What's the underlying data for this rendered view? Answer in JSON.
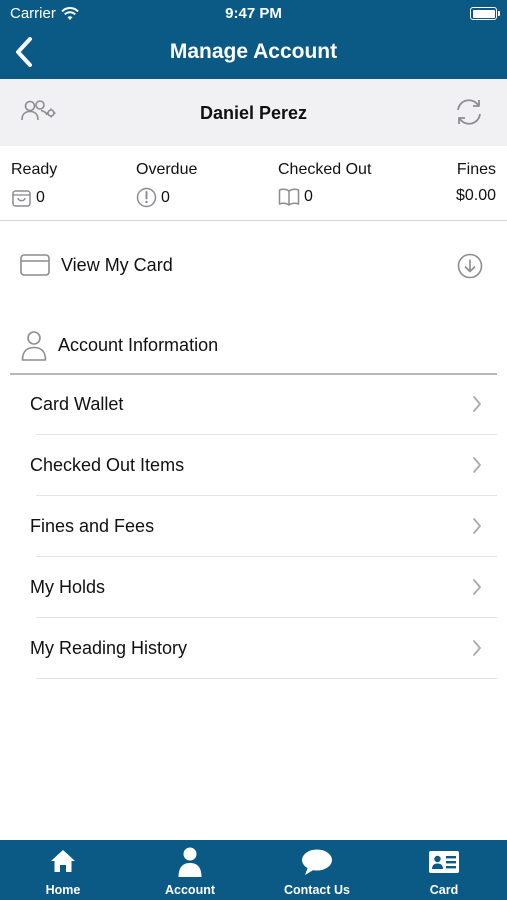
{
  "status_bar": {
    "carrier": "Carrier",
    "time": "9:47 PM",
    "battery_level": 1.0
  },
  "nav": {
    "title": "Manage Account",
    "back_icon": "chevron-left-icon"
  },
  "profile": {
    "name": "Daniel Perez",
    "left_icon": "user-switch-icon",
    "right_icon": "refresh-icon"
  },
  "stats": {
    "ready": {
      "label": "Ready",
      "value": "0",
      "icon": "bag-icon"
    },
    "overdue": {
      "label": "Overdue",
      "value": "0",
      "icon": "alert-icon"
    },
    "checked_out": {
      "label": "Checked Out",
      "value": "0",
      "icon": "book-icon"
    },
    "fines": {
      "label": "Fines",
      "value": "$0.00"
    }
  },
  "view_card": {
    "label": "View My Card",
    "icon": "credit-card-icon",
    "action_icon": "download-circle-icon"
  },
  "account": {
    "label": "Account Information",
    "icon": "person-icon",
    "items": [
      {
        "label": "Card Wallet"
      },
      {
        "label": "Checked Out Items"
      },
      {
        "label": "Fines and Fees"
      },
      {
        "label": "My Holds"
      },
      {
        "label": "My Reading History"
      }
    ]
  },
  "tabs": [
    {
      "label": "Home",
      "icon": "home-icon"
    },
    {
      "label": "Account",
      "icon": "account-icon"
    },
    {
      "label": "Contact Us",
      "icon": "chat-bubble-icon"
    },
    {
      "label": "Card",
      "icon": "id-card-icon"
    }
  ],
  "colors": {
    "brand": "#0a5a85",
    "profile_bg": "#f1f1f4",
    "icon_gray": "#8c8c92"
  }
}
